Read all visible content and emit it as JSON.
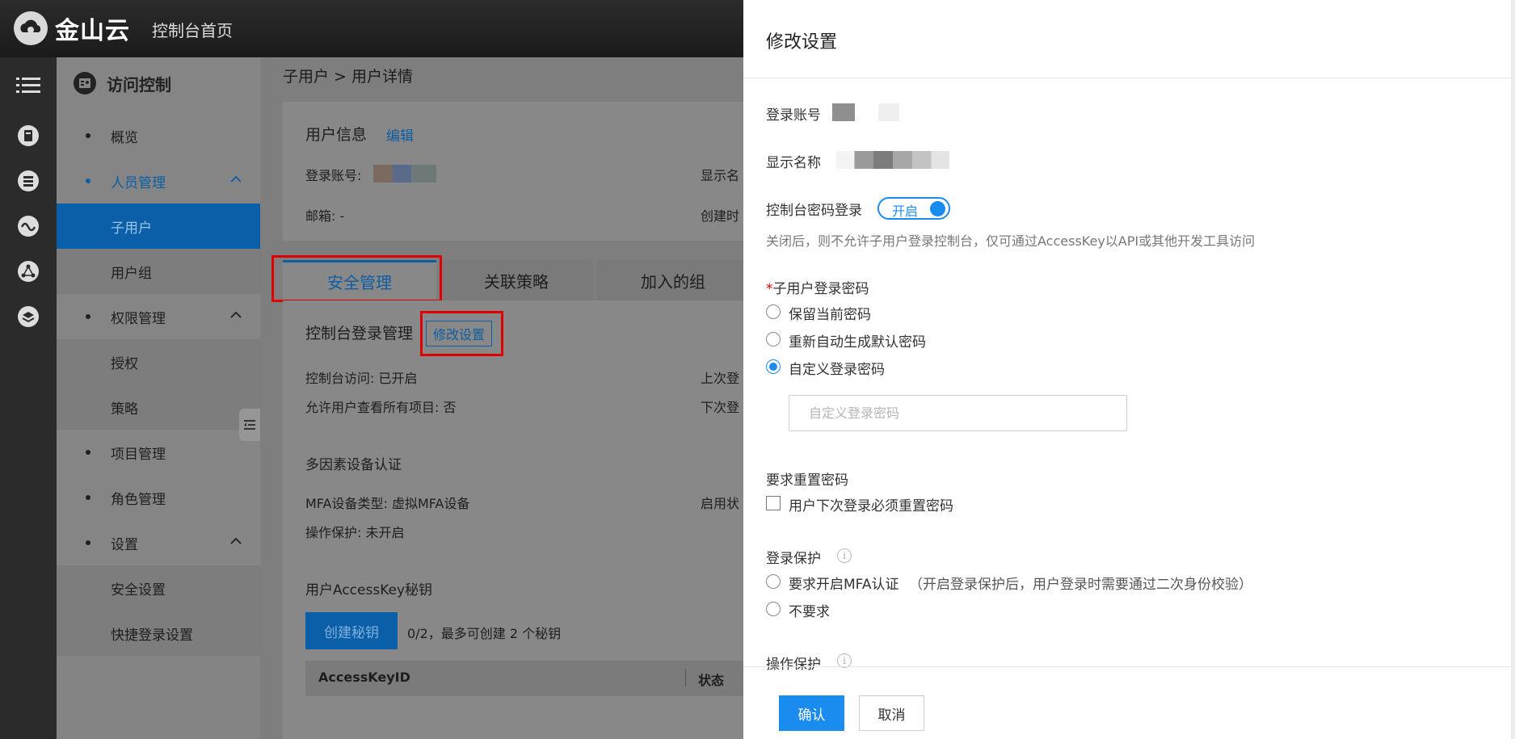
{
  "topbar": {
    "brand": "金山云",
    "home": "控制台首页"
  },
  "sidebar": {
    "title": "访问控制",
    "items": [
      {
        "label": "概览"
      },
      {
        "label": "人员管理"
      },
      {
        "label": "子用户"
      },
      {
        "label": "用户组"
      },
      {
        "label": "权限管理"
      },
      {
        "label": "授权"
      },
      {
        "label": "策略"
      },
      {
        "label": "项目管理"
      },
      {
        "label": "角色管理"
      },
      {
        "label": "设置"
      },
      {
        "label": "安全设置"
      },
      {
        "label": "快捷登录设置"
      }
    ]
  },
  "main": {
    "breadcrumb": "子用户 > 用户详情",
    "user_info": {
      "title": "用户信息",
      "edit": "编辑",
      "login_account_label": "登录账号:",
      "display_name_label": "显示名",
      "email": "邮箱: -",
      "created_label": "创建时"
    },
    "tabs": [
      "安全管理",
      "关联策略",
      "加入的组"
    ],
    "console_login": {
      "title": "控制台登录管理",
      "modify_button": "修改设置",
      "access": "控制台访问: 已开启",
      "last_login": "上次登",
      "view_all": "允许用户查看所有项目: 否",
      "next_login": "下次登"
    },
    "mfa": {
      "title": "多因素设备认证",
      "device_type": "MFA设备类型: 虚拟MFA设备",
      "enabled_status": "启用状",
      "op_protect": "操作保护: 未开启"
    },
    "access_key": {
      "title": "用户AccessKey秘钥",
      "create_button": "创建秘钥",
      "quota": "0/2，最多可创建 2 个秘钥",
      "columns": [
        "AccessKeyID",
        "状态"
      ]
    }
  },
  "drawer": {
    "title": "修改设置",
    "login_account_label": "登录账号",
    "display_name_label": "显示名称",
    "console_password_label": "控制台密码登录",
    "toggle_label": "开启",
    "toggle_on": true,
    "console_hint": "关闭后，则不允许子用户登录控制台，仅可通过AccessKey以API或其他开发工具访问",
    "password_section": "子用户登录密码",
    "required_mark": "*",
    "password_options": [
      "保留当前密码",
      "重新自动生成默认密码",
      "自定义登录密码"
    ],
    "selected_password_option": "自定义登录密码",
    "custom_password": {
      "value": "",
      "placeholder": "自定义登录密码"
    },
    "reset_section": "要求重置密码",
    "reset_checkbox_label": "用户下次登录必须重置密码",
    "reset_checked": false,
    "login_protect_section": "登录保护",
    "login_protect_options": [
      "要求开启MFA认证",
      "不要求"
    ],
    "login_protect_note": "（开启登录保护后，用户登录时需要通过二次身份校验）",
    "op_protect_section": "操作保护",
    "confirm": "确认",
    "cancel": "取消"
  },
  "colors": {
    "accent": "#1a8cf0",
    "sidebar_active": "#0b5fa8",
    "highlight": "#e10000"
  }
}
